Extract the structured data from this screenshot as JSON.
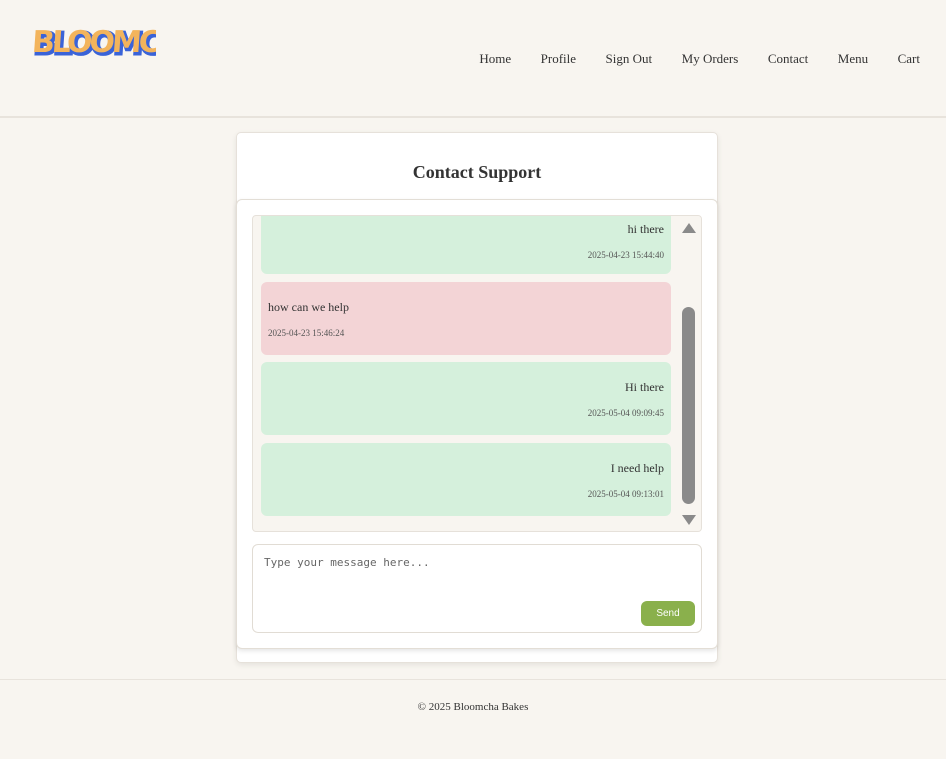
{
  "brand": {
    "logo_text": "BLOOMCHA"
  },
  "nav": [
    {
      "label": "Home"
    },
    {
      "label": "Profile"
    },
    {
      "label": "Sign Out"
    },
    {
      "label": "My Orders"
    },
    {
      "label": "Contact"
    },
    {
      "label": "Menu"
    },
    {
      "label": "Cart"
    }
  ],
  "page": {
    "title": "Contact Support"
  },
  "messages": [
    {
      "sender": "user",
      "text": "hi there",
      "time": "2025-04-23 15:44:40"
    },
    {
      "sender": "support",
      "text": "how can we help",
      "time": "2025-04-23 15:46:24"
    },
    {
      "sender": "user",
      "text": "Hi there",
      "time": "2025-05-04 09:09:45"
    },
    {
      "sender": "user",
      "text": "I need help",
      "time": "2025-05-04 09:13:01"
    }
  ],
  "composer": {
    "placeholder": "Type your message here...",
    "send_label": "Send"
  },
  "footer": {
    "text": "© 2025 Bloomcha Bakes"
  },
  "colors": {
    "user_bubble": "#d5f0dc",
    "support_bubble": "#f3d4d6",
    "send_button": "#8ab04c",
    "logo_fill": "#f3b45c",
    "logo_outline": "#3a63d8"
  }
}
